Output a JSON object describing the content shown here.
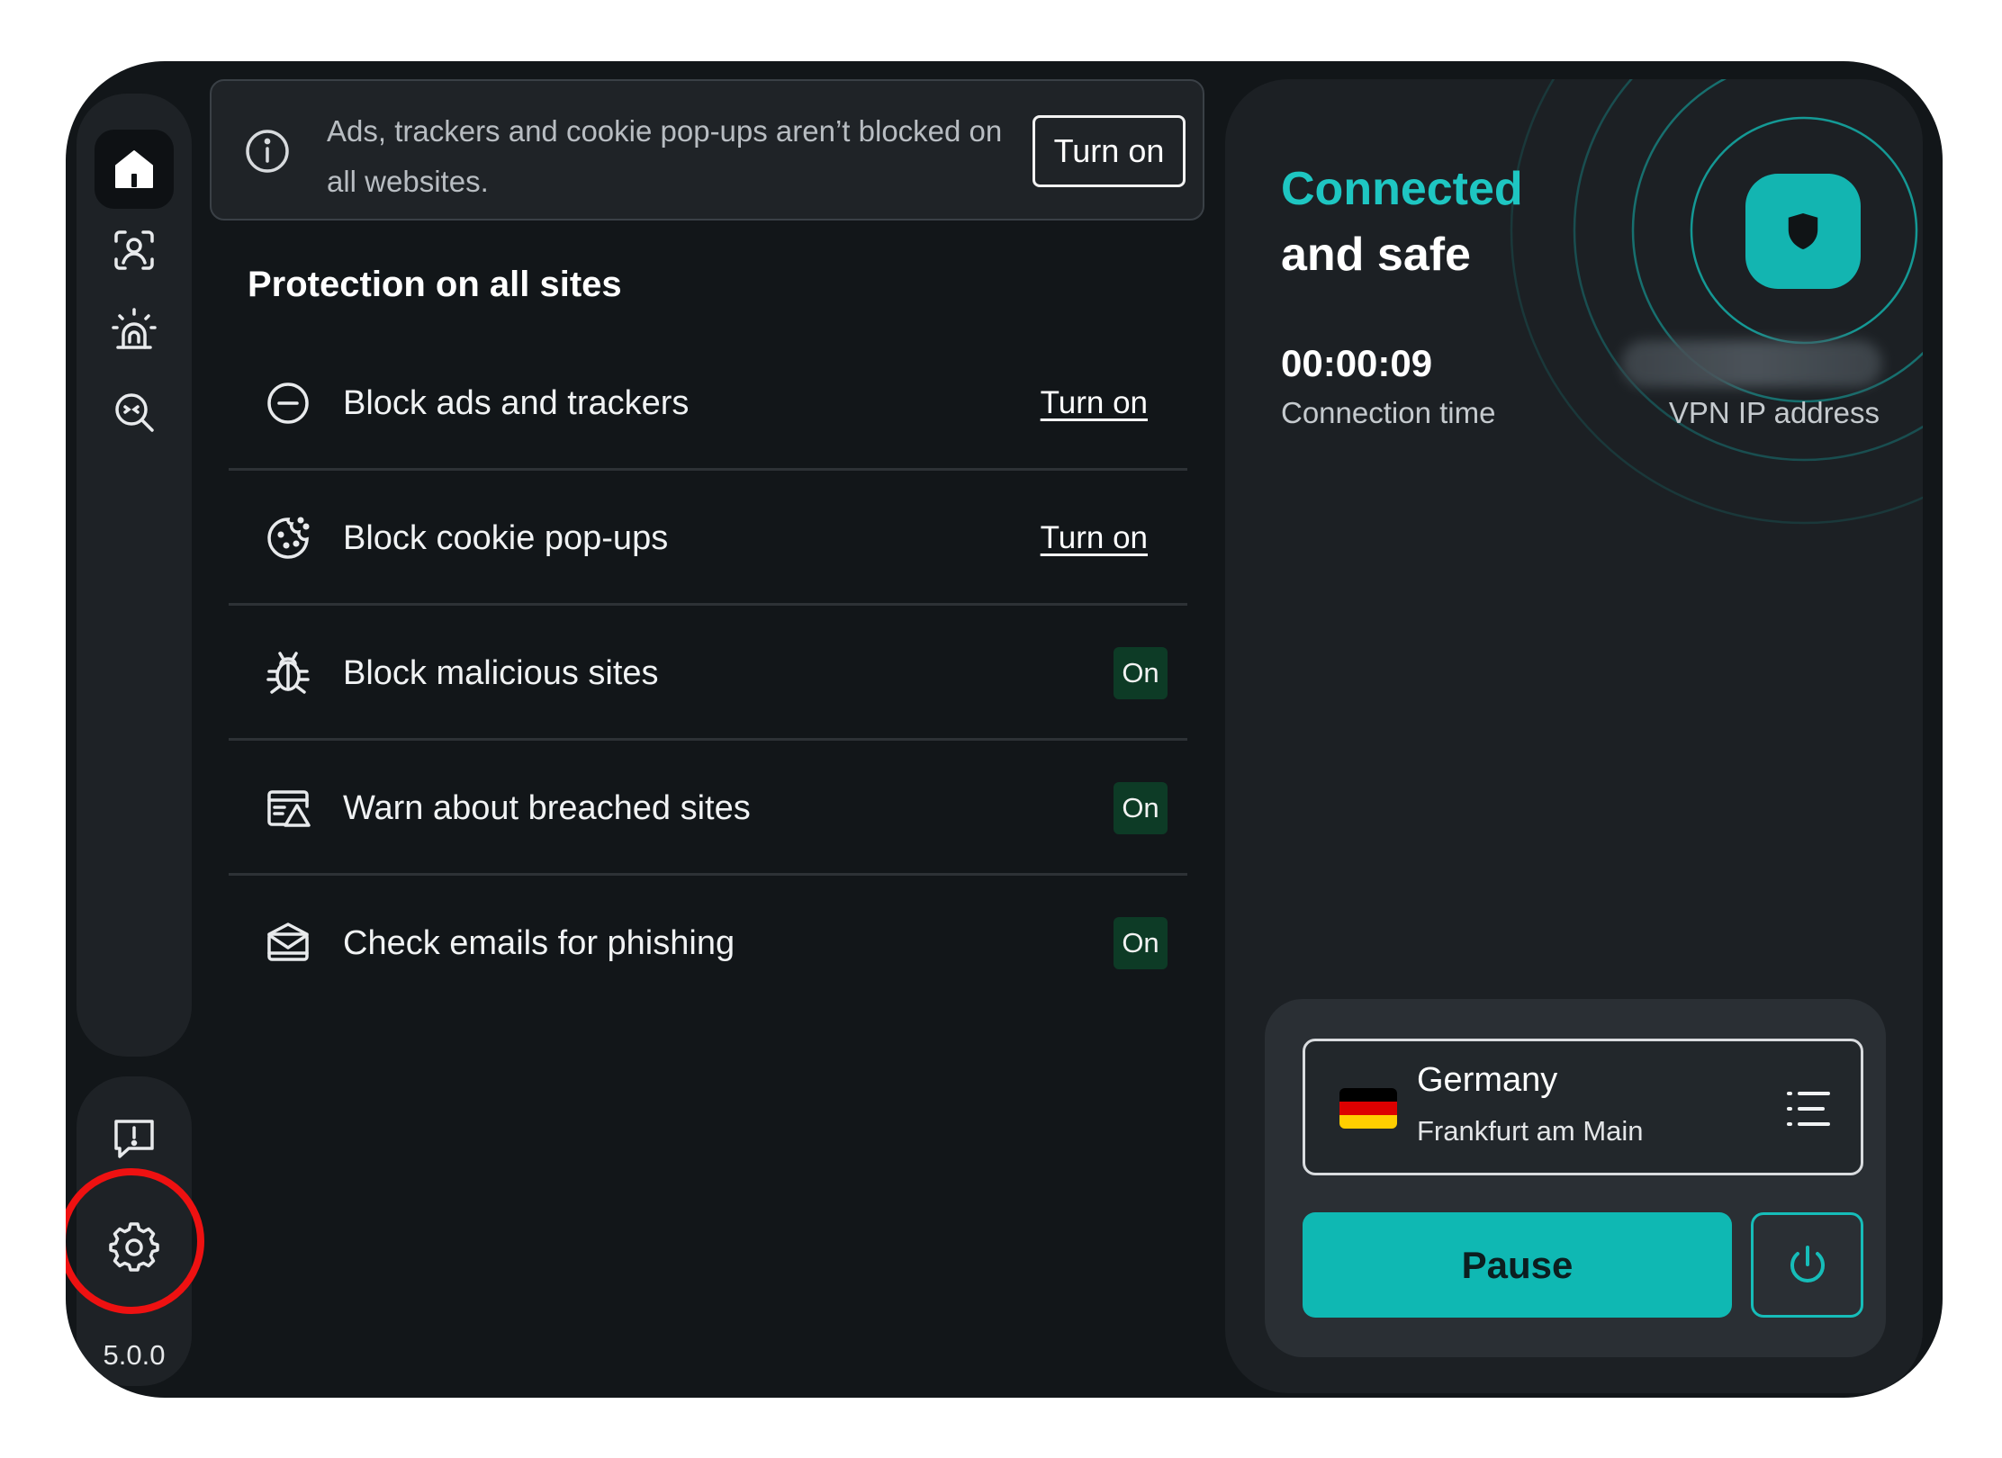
{
  "sidebar": {
    "items": [
      {
        "icon": "home-icon"
      },
      {
        "icon": "identity-scan-icon"
      },
      {
        "icon": "alarm-icon"
      },
      {
        "icon": "search-threat-icon"
      }
    ],
    "feedback_icon": "feedback-icon",
    "settings_icon": "gear-icon",
    "version": "5.0.0"
  },
  "banner": {
    "text": "Ads, trackers and cookie pop-ups aren’t blocked on all websites.",
    "button_label": "Turn on"
  },
  "protection": {
    "title": "Protection on all sites",
    "features": [
      {
        "label": "Block ads and trackers",
        "action": "Turn on",
        "icon": "block-ads-icon"
      },
      {
        "label": "Block cookie pop-ups",
        "action": "Turn on",
        "icon": "cookie-icon"
      },
      {
        "label": "Block malicious sites",
        "status": "On",
        "icon": "bug-icon"
      },
      {
        "label": "Warn about breached sites",
        "status": "On",
        "icon": "breached-site-icon"
      },
      {
        "label": "Check emails for phishing",
        "status": "On",
        "icon": "email-phishing-icon"
      }
    ]
  },
  "vpn": {
    "status_line1": "Connected",
    "status_line2": "and safe",
    "connection_time": "00:00:09",
    "connection_time_label": "Connection time",
    "ip_label": "VPN IP address",
    "location": {
      "country": "Germany",
      "city": "Frankfurt am Main"
    },
    "pause_label": "Pause"
  },
  "colors": {
    "accent": "#13b5b1",
    "background": "#121619",
    "panel": "#1c2024",
    "badge_on": "#0d3b26",
    "highlight": "#ee1111"
  }
}
